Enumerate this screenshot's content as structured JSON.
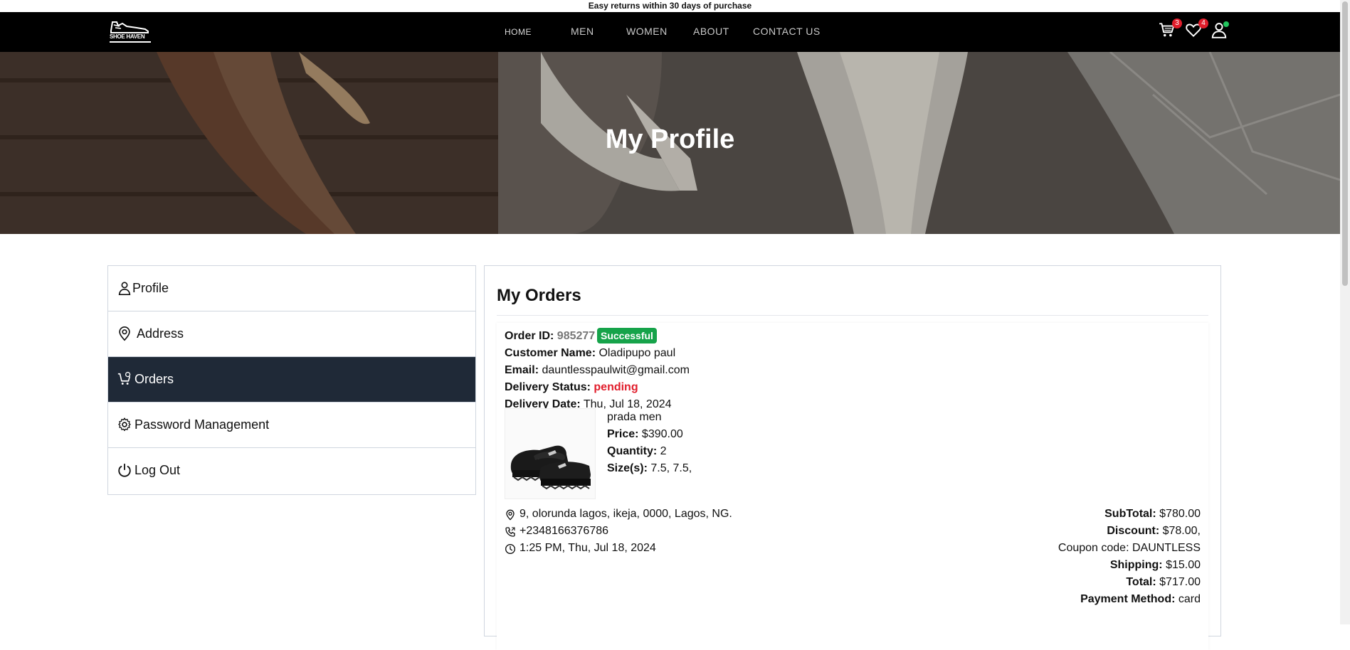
{
  "announcement": "Easy returns within 30 days of purchase",
  "logo": {
    "text": "SHOE HAVEN"
  },
  "nav": {
    "home": "HOME",
    "men": "MEN",
    "women": "WOMEN",
    "about": "ABOUT",
    "contact": "CONTACT US",
    "cart_count": "3",
    "wishlist_count": "4",
    "icons": [
      "cart-icon",
      "heart-icon",
      "user-icon"
    ]
  },
  "hero": {
    "title": "My Profile"
  },
  "sidebar": {
    "items": [
      {
        "label": "Profile",
        "icon": "user-icon"
      },
      {
        "label": "Address",
        "icon": "location-pin-icon"
      },
      {
        "label": "Orders",
        "icon": "cart-icon",
        "active": true
      },
      {
        "label": "Password Management",
        "icon": "gear-icon"
      },
      {
        "label": "Log Out",
        "icon": "power-icon"
      }
    ]
  },
  "orders": {
    "title": "My Orders",
    "order": {
      "id_label": "Order ID:",
      "id": "985277",
      "status": "Successful",
      "customer_label": "Customer Name:",
      "customer": "Oladipupo paul",
      "email_label": "Email:",
      "email": "dauntlesspaulwit@gmail.com",
      "delivery_status_label": "Delivery Status:",
      "delivery_status": "pending",
      "delivery_date_label": "Delivery Date:",
      "delivery_date": "Thu, Jul 18, 2024",
      "product": {
        "name": "prada men",
        "price_label": "Price:",
        "price": "$390.00",
        "quantity_label": "Quantity:",
        "quantity": "2",
        "sizes_label": "Size(s):",
        "sizes": "7.5, 7.5,"
      },
      "address": "9, olorunda lagos, ikeja, 0000, Lagos, NG.",
      "phone": "+2348166376786",
      "time": "1:25 PM, Thu, Jul 18, 2024",
      "subtotal_label": "SubTotal:",
      "subtotal": "$780.00",
      "discount_label": "Discount:",
      "discount": "$78.00,",
      "coupon": "Coupon code: DAUNTLESS",
      "shipping_label": "Shipping:",
      "shipping": "$15.00",
      "total_label": "Total:",
      "total": "$717.00",
      "payment_label": "Payment Method:",
      "payment": "card"
    }
  },
  "colors": {
    "navbar": "#000000",
    "active_sidebar": "#1f2937",
    "success": "#16a34a",
    "pending": "#e11d2b",
    "badge": "#e11d2b",
    "online": "#22c55e"
  }
}
